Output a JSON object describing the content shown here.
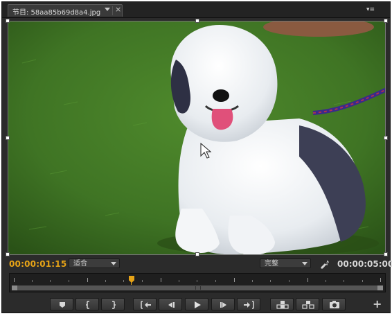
{
  "tab": {
    "title": "节目: 58aa85b69d8a4.jpg",
    "close": "×"
  },
  "panel_menu": "▾≡",
  "playback": {
    "current_timecode": "00:00:01:15",
    "duration_timecode": "00:00:05:00",
    "zoom_select": "适合",
    "quality_select": "完整"
  },
  "scrubber": {
    "playhead_position": 0.32
  },
  "transport_buttons": [
    "add-marker-button",
    "mark-in-button",
    "mark-out-button",
    "go-to-in-button",
    "step-back-button",
    "play-button",
    "step-forward-button",
    "go-to-out-button",
    "lift-button",
    "extract-button",
    "export-frame-button"
  ],
  "add_button": "+",
  "colors": {
    "timecode_accent": "#e6a317",
    "panel_bg": "#2b2b2b"
  }
}
